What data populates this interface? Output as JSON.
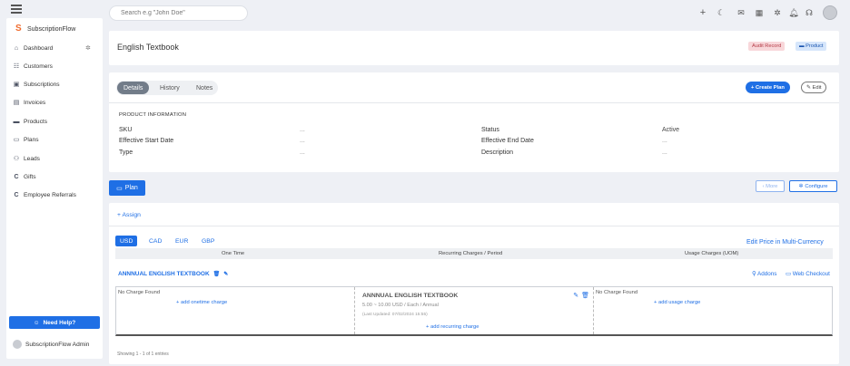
{
  "header": {
    "search_placeholder": "Search e.g \"John Doe\"",
    "icons": [
      "plus-icon",
      "moon-icon",
      "mail-icon",
      "calendar-icon",
      "gear-icon",
      "bell-icon",
      "headset-icon",
      "user-avatar"
    ]
  },
  "sidebar": {
    "brand": "SubscriptionFlow",
    "items": [
      {
        "label": "Dashboard",
        "icon": "home-icon"
      },
      {
        "label": "Customers",
        "icon": "users-icon"
      },
      {
        "label": "Subscriptions",
        "icon": "subscription-icon"
      },
      {
        "label": "Invoices",
        "icon": "invoice-icon"
      },
      {
        "label": "Products",
        "icon": "box-icon"
      },
      {
        "label": "Plans",
        "icon": "plans-icon"
      },
      {
        "label": "Leads",
        "icon": "leads-icon"
      },
      {
        "label": "Gifts",
        "icon": "gift-icon"
      },
      {
        "label": "Employee Referrals",
        "icon": "referral-icon"
      }
    ],
    "help_label": "Need Help?",
    "admin_name": "SubscriptionFlow Admin"
  },
  "title_card": {
    "title": "English Textbook",
    "audit_label": "Audit Record",
    "product_label": "Product"
  },
  "details": {
    "tabs": [
      "Details",
      "History",
      "Notes"
    ],
    "create_plan_label": "+ Create Plan",
    "edit_label": "Edit",
    "section_title": "PRODUCT INFORMATION",
    "left_props": [
      {
        "label": "SKU",
        "value": "..."
      },
      {
        "label": "Effective Start Date",
        "value": "..."
      },
      {
        "label": "Type",
        "value": "..."
      }
    ],
    "right_props": [
      {
        "label": "Status",
        "value": "Active"
      },
      {
        "label": "Effective End Date",
        "value": "..."
      },
      {
        "label": "Description",
        "value": "..."
      }
    ]
  },
  "plan_bar": {
    "plan_label": "Plan",
    "more_label": "‹ More",
    "configure_label": "Configure"
  },
  "plan_card": {
    "assign_label": "+ Assign",
    "currencies": [
      "USD",
      "CAD",
      "EUR",
      "GBP"
    ],
    "edit_price_label": "Edit Price in Multi-Currency",
    "columns": [
      "One Time",
      "Recurring Charges / Period",
      "Usage Charges (UOM)"
    ],
    "plan_name": "ANNNUAL ENGLISH TEXTBOOK",
    "addons_label": "Addons",
    "webcheckout_label": "Web Checkout",
    "one_time": {
      "no_charge": "No Charge Found",
      "add_label": "+ add onetime charge"
    },
    "recurring": {
      "title": "ANNNUAL ENGLISH TEXTBOOK",
      "price": "5.00 ~ 10.00 USD / Each / Annual",
      "updated": "(Last Updated: 07/02/2024 15:55)",
      "add_label": "+ add recurring charge"
    },
    "usage": {
      "no_charge": "No Charge Found",
      "add_label": "+ add usage charge"
    },
    "showing": "Showing 1 - 1 of 1 entries"
  },
  "colors": {
    "accent": "#1f6fe5",
    "audit": "#f8d7da",
    "product": "#d6e6fb"
  }
}
